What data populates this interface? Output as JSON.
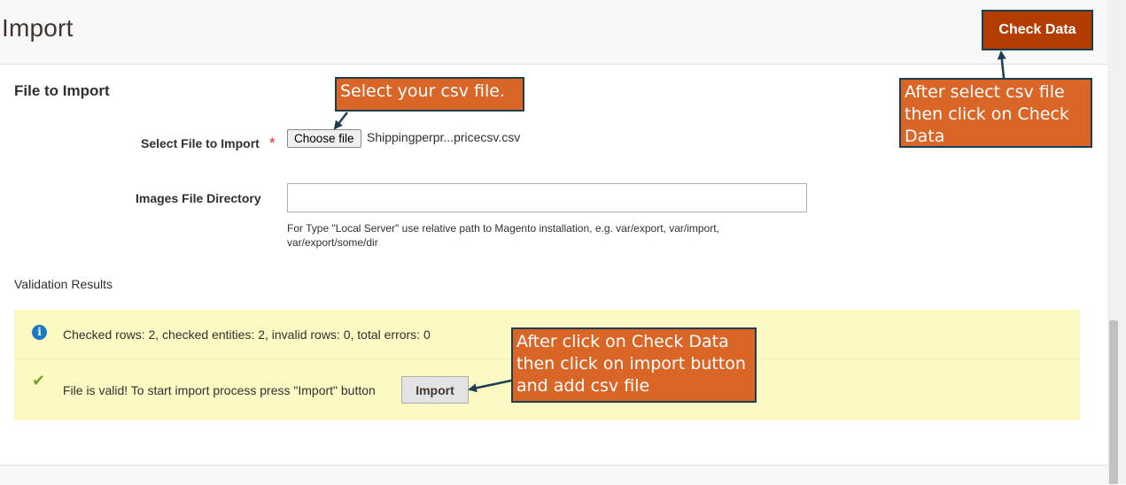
{
  "header": {
    "title": "Import",
    "check_data_label": "Check Data"
  },
  "form": {
    "section_title": "File to Import",
    "select_file_label": "Select File to Import",
    "required_mark": "*",
    "choose_file_label": "Choose file",
    "selected_file_name": "Shippingperpr...pricecsv.csv",
    "images_dir_label": "Images File Directory",
    "images_dir_value": "",
    "images_dir_note": "For Type \"Local Server\" use relative path to Magento installation, e.g. var/export, var/import, var/export/some/dir"
  },
  "validation": {
    "title": "Validation Results",
    "info_message": "Checked rows: 2, checked entities: 2, invalid rows: 0, total errors: 0",
    "success_message": "File is valid! To start import process press \"Import\" button",
    "import_button_label": "Import",
    "info_icon": "info-icon",
    "success_icon": "check-icon"
  },
  "callouts": {
    "select_csv": "Select your csv file.",
    "check_data": "After select csv file then click on Check Data",
    "import": "After click on Check Data then click on import button and add csv file"
  },
  "colors": {
    "primary_button": "#b33d00",
    "callout_bg": "#d96527",
    "callout_border": "#1c3f4f",
    "message_bg": "#fdf9c3",
    "info_icon": "#1979c3",
    "success_icon": "#79a22e"
  }
}
